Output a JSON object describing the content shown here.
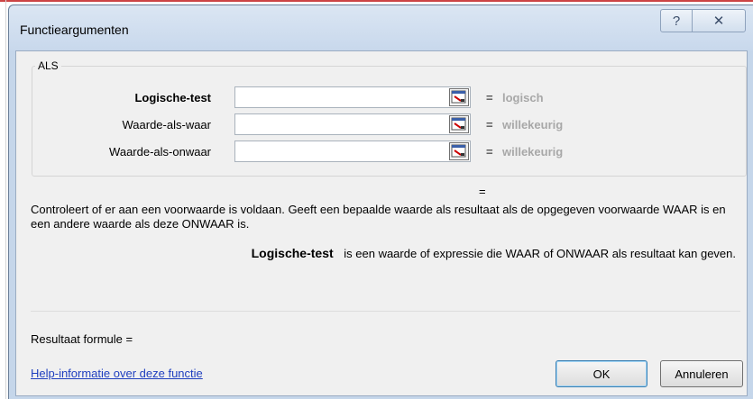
{
  "dialog": {
    "title": "Functieargumenten",
    "help_button": "?",
    "close_button": "✕"
  },
  "function_group": {
    "name": "ALS",
    "arguments": [
      {
        "label": "Logische-test",
        "bold": true,
        "value": "",
        "equals": "=",
        "type_hint": "logisch"
      },
      {
        "label": "Waarde-als-waar",
        "bold": false,
        "value": "",
        "equals": "=",
        "type_hint": "willekeurig"
      },
      {
        "label": "Waarde-als-onwaar",
        "bold": false,
        "value": "",
        "equals": "=",
        "type_hint": "willekeurig"
      }
    ]
  },
  "result_equals": "=",
  "description": "Controleert of er aan een voorwaarde is voldaan. Geeft een bepaalde waarde als resultaat als de opgegeven voorwaarde WAAR is en een andere waarde als deze ONWAAR is.",
  "param_help": {
    "name": "Logische-test",
    "text": "is een waarde of expressie die WAAR of ONWAAR als resultaat kan geven."
  },
  "result_formula": "Resultaat formule =",
  "help_link": "Help-informatie over deze functie",
  "buttons": {
    "ok": "OK",
    "cancel": "Annuleren"
  },
  "icons": {
    "collapse": "collapse-dialog-icon",
    "help": "question-mark-icon",
    "close": "close-icon"
  }
}
